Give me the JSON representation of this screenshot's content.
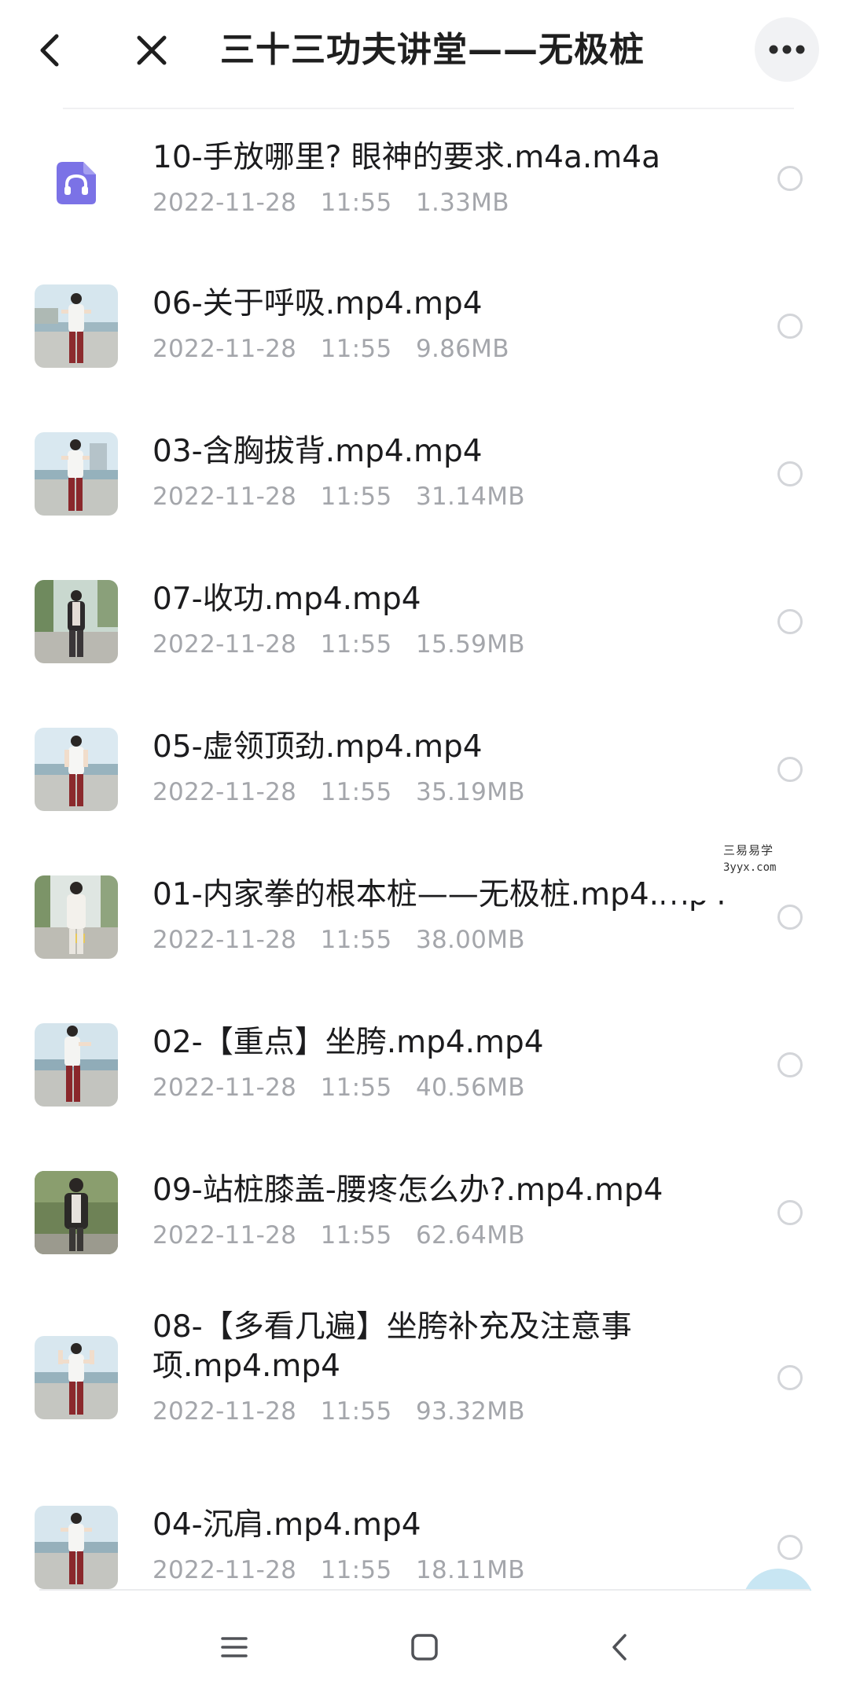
{
  "header": {
    "title": "三十三功夫讲堂——无极桩",
    "back_icon": "chevron-left-icon",
    "close_icon": "close-icon",
    "more_icon": "more-horizontal-icon"
  },
  "files": [
    {
      "name": "10-手放哪里? 眼神的要求.m4a.m4a",
      "date": "2022-11-28",
      "time": "11:55",
      "size": "1.33MB",
      "type": "audio"
    },
    {
      "name": "06-关于呼吸.mp4.mp4",
      "date": "2022-11-28",
      "time": "11:55",
      "size": "9.86MB",
      "type": "video"
    },
    {
      "name": "03-含胸拔背.mp4.mp4",
      "date": "2022-11-28",
      "time": "11:55",
      "size": "31.14MB",
      "type": "video"
    },
    {
      "name": "07-收功.mp4.mp4",
      "date": "2022-11-28",
      "time": "11:55",
      "size": "15.59MB",
      "type": "video"
    },
    {
      "name": "05-虚领顶劲.mp4.mp4",
      "date": "2022-11-28",
      "time": "11:55",
      "size": "35.19MB",
      "type": "video"
    },
    {
      "name": "01-内家拳的根本桩——无极桩.mp4.mp4",
      "date": "2022-11-28",
      "time": "11:55",
      "size": "38.00MB",
      "type": "video"
    },
    {
      "name": "02-【重点】坐胯.mp4.mp4",
      "date": "2022-11-28",
      "time": "11:55",
      "size": "40.56MB",
      "type": "video"
    },
    {
      "name": "09-站桩膝盖-腰疼怎么办?.mp4.mp4",
      "date": "2022-11-28",
      "time": "11:55",
      "size": "62.64MB",
      "type": "video"
    },
    {
      "name": "08-【多看几遍】坐胯补充及注意事项.mp4.mp4",
      "date": "2022-11-28",
      "time": "11:55",
      "size": "93.32MB",
      "type": "video"
    },
    {
      "name": "04-沉肩.mp4.mp4",
      "date": "2022-11-28",
      "time": "11:55",
      "size": "18.11MB",
      "type": "video"
    }
  ],
  "watermark": {
    "line1": "三易易学",
    "line2": "3yyx.com"
  },
  "colors": {
    "title": "#1f1f1f",
    "meta": "#a4a6ab",
    "audio_tile": "#7b72e6",
    "radio_border": "#d3d5d9",
    "fab": "#c8e6f3"
  },
  "nav": {
    "menu_icon": "menu-icon",
    "home_icon": "home-square-icon",
    "back_icon": "back-triangle-icon"
  }
}
